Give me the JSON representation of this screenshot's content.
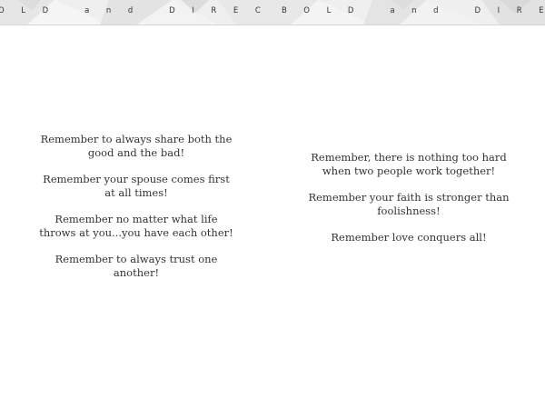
{
  "header": {
    "left": "OLD and DIRECT",
    "right": "BOLD and DIREC"
  },
  "left_page": {
    "items": [
      {
        "lines": [
          "Remember to always share both the",
          "good and the bad!"
        ]
      },
      {
        "lines": [
          "Remember your spouse comes first",
          "at all times!"
        ]
      },
      {
        "lines": [
          "Remember no matter what life",
          "throws at you...you have each other!"
        ]
      },
      {
        "lines": [
          "Remember to always trust one",
          "another!"
        ]
      }
    ]
  },
  "right_page": {
    "items": [
      {
        "lines": [
          "Remember, there is nothing too hard",
          "when two people work together!"
        ]
      },
      {
        "lines": [
          "Remember your faith is stronger than",
          "foolishness!"
        ]
      },
      {
        "lines": [
          "Remember love conquers all!"
        ]
      }
    ]
  },
  "colors": {
    "text": "#333333",
    "header_band": "#eeeeee"
  }
}
